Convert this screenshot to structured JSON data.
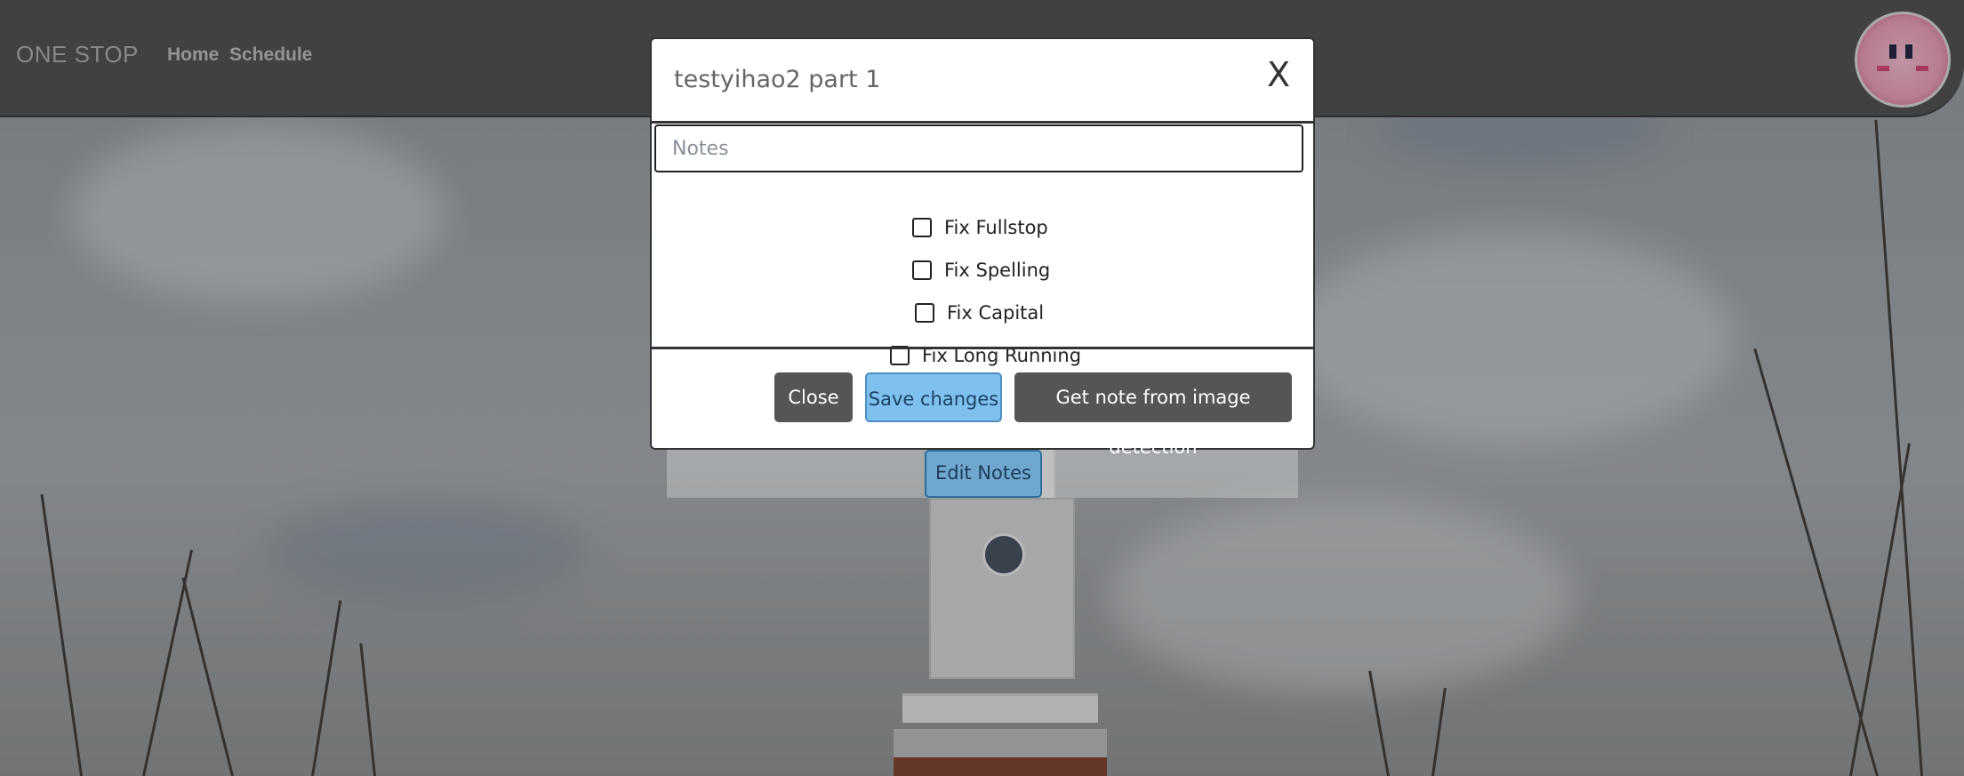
{
  "navbar": {
    "brand": "ONE STOP",
    "links": [
      "Home",
      "Schedule"
    ]
  },
  "background": {
    "edit_notes_label": "Edit Notes"
  },
  "modal": {
    "title": "testyihao2 part 1",
    "close_symbol": "X",
    "notes_placeholder": "Notes",
    "notes_value": "",
    "checkboxes": [
      {
        "label": "Fix Fullstop",
        "checked": false
      },
      {
        "label": "Fix Spelling",
        "checked": false
      },
      {
        "label": "Fix Capital",
        "checked": false
      },
      {
        "label": "Fix Long Running",
        "checked": false
      }
    ],
    "buttons": {
      "close": "Close",
      "save": "Save changes",
      "detect": "Get note from image detection"
    }
  },
  "colors": {
    "navbar": "#4a4a4a",
    "primary_button": "#7ec0ee",
    "secondary_button": "#555555"
  }
}
